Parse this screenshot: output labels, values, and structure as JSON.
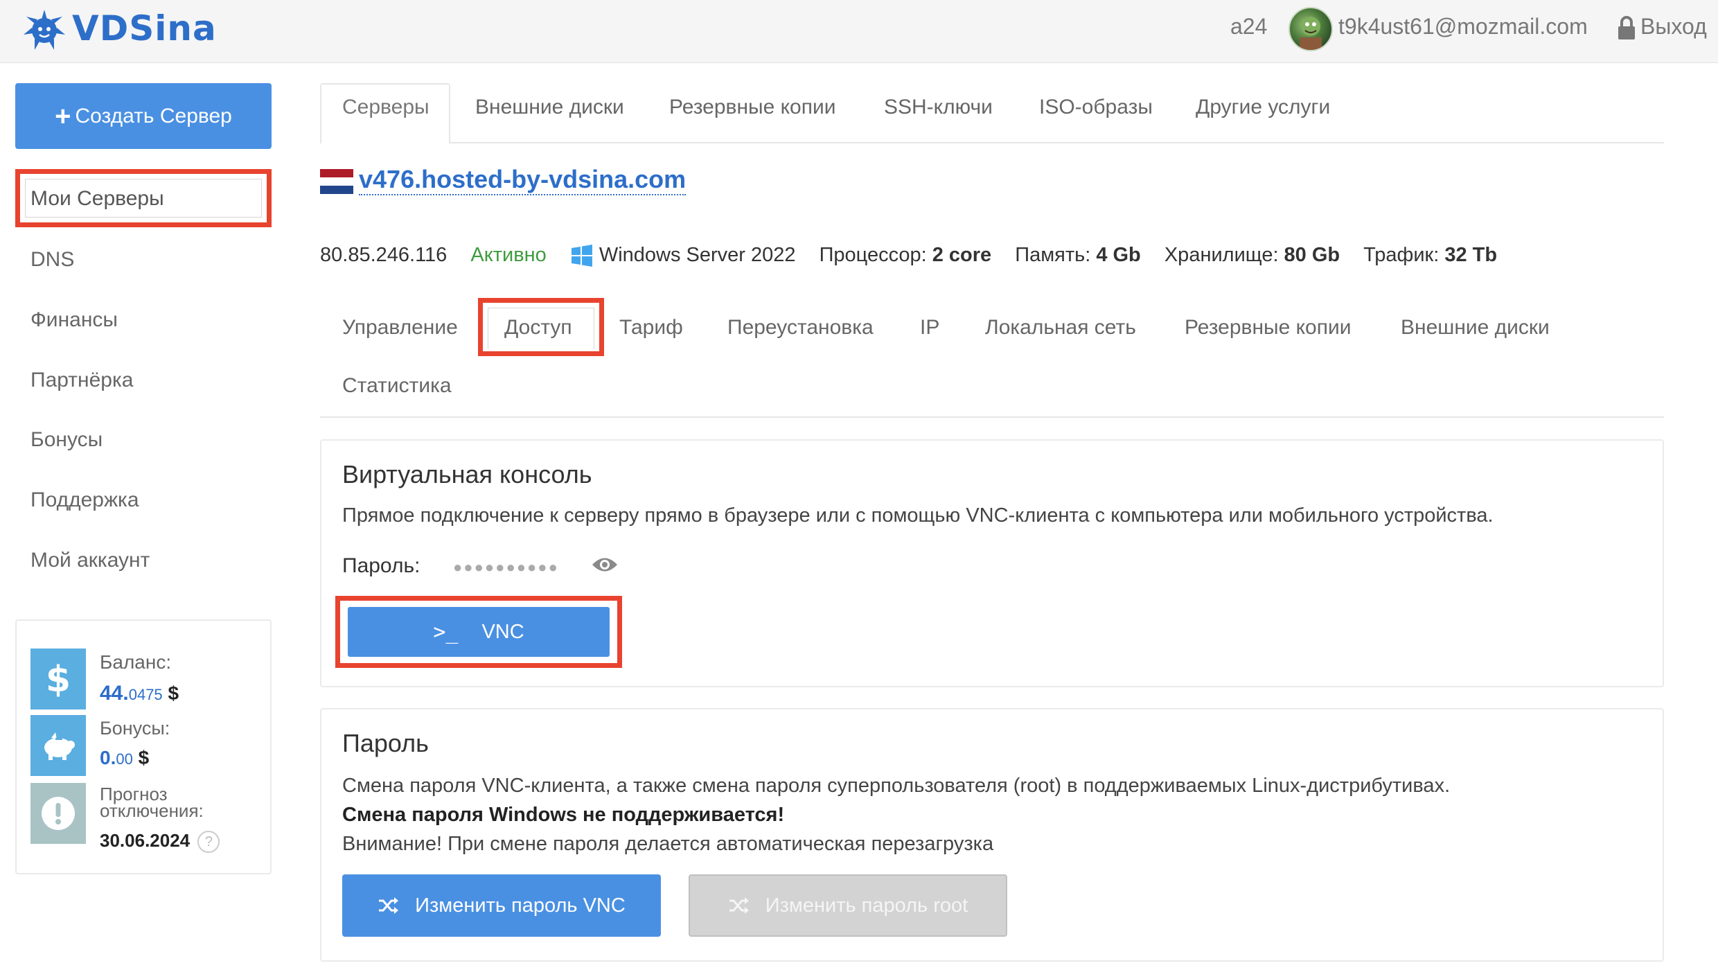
{
  "header": {
    "brand": "VDSina",
    "account_id": "a24",
    "email": "t9k4ust61@mozmail.com",
    "logout_label": "Выход"
  },
  "sidebar": {
    "create_button": "Создать Сервер",
    "items": [
      {
        "label": "Мои Серверы",
        "active": true
      },
      {
        "label": "DNS"
      },
      {
        "label": "Финансы"
      },
      {
        "label": "Партнёрка"
      },
      {
        "label": "Бонусы"
      },
      {
        "label": "Поддержка"
      },
      {
        "label": "Мой аккаунт"
      }
    ],
    "balance": {
      "balance_label": "Баланс:",
      "balance_main": "44.",
      "balance_fraction": "0475",
      "balance_currency": "$",
      "bonus_label": "Бонусы:",
      "bonus_main": "0.",
      "bonus_fraction": "00",
      "bonus_currency": "$",
      "forecast_label_1": "Прогноз",
      "forecast_label_2": "отключения:",
      "forecast_date": "30.06.2024",
      "help_glyph": "?"
    }
  },
  "top_tabs": [
    {
      "label": "Серверы",
      "active": true
    },
    {
      "label": "Внешние диски"
    },
    {
      "label": "Резервные копии"
    },
    {
      "label": "SSH-ключи"
    },
    {
      "label": "ISO-образы"
    },
    {
      "label": "Другие услуги"
    }
  ],
  "server": {
    "hostname": "v476.hosted-by-vdsina.com",
    "ip": "80.85.246.116",
    "status": "Активно",
    "os": "Windows Server 2022",
    "cpu_label": "Процессор:",
    "cpu_value": "2 core",
    "ram_label": "Память:",
    "ram_value": "4 Gb",
    "storage_label": "Хранилище:",
    "storage_value": "80 Gb",
    "traffic_label": "Трафик:",
    "traffic_value": "32 Tb"
  },
  "server_tabs": [
    {
      "label": "Управление"
    },
    {
      "label": "Доступ",
      "active": true
    },
    {
      "label": "Тариф"
    },
    {
      "label": "Переустановка"
    },
    {
      "label": "IP"
    },
    {
      "label": "Локальная сеть"
    },
    {
      "label": "Резервные копии"
    },
    {
      "label": "Внешние диски"
    },
    {
      "label": "Статистика"
    }
  ],
  "console_panel": {
    "title": "Виртуальная консоль",
    "description": "Прямое подключение к серверу прямо в браузере или с помощью VNC-клиента с компьютера или мобильного устройства.",
    "password_label": "Пароль:",
    "password_mask": "●●●●●●●●●●",
    "vnc_icon": ">_",
    "vnc_button": "VNC"
  },
  "password_panel": {
    "title": "Пароль",
    "line1": "Смена пароля VNC-клиента, а также смена пароля суперпользователя (root) в поддерживаемых Linux-дистрибутивах.",
    "line2": "Смена пароля Windows не поддерживается!",
    "line3": "Внимание! При смене пароля делается автоматическая перезагрузка",
    "vnc_button": "Изменить пароль VNC",
    "root_button": "Изменить пароль root"
  },
  "colors": {
    "brand_blue": "#4a90e2",
    "link_blue": "#2d6ec9",
    "highlight_red": "#e8432f",
    "status_green": "#3f9b3f",
    "sidebar_icon_bg": "#5aaee0"
  }
}
